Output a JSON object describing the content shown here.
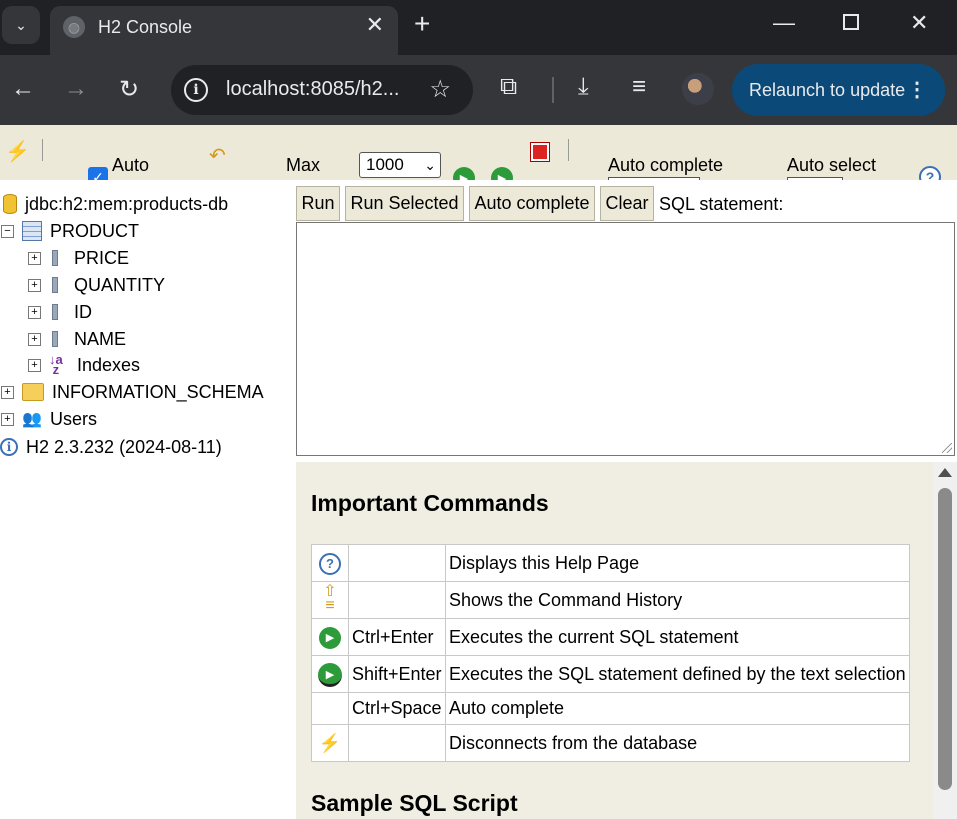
{
  "browser": {
    "tab_title": "H2 Console",
    "url": "localhost:8085/h2...",
    "relaunch_label": "Relaunch to update"
  },
  "h2_toolbar": {
    "auto_commit_label": "Auto",
    "auto_commit_checked": true,
    "max_label": "Max",
    "max_value": "1000",
    "auto_complete_label": "Auto complete",
    "auto_select_label": "Auto select"
  },
  "tree": {
    "connection": "jdbc:h2:mem:products-db",
    "table": "PRODUCT",
    "columns": [
      "PRICE",
      "QUANTITY",
      "ID",
      "NAME"
    ],
    "indexes": "Indexes",
    "schema": "INFORMATION_SCHEMA",
    "users": "Users",
    "version": "H2 2.3.232 (2024-08-11)"
  },
  "query": {
    "run": "Run",
    "run_selected": "Run Selected",
    "auto_complete": "Auto complete",
    "clear": "Clear",
    "sql_label": "SQL statement:",
    "sql_text": ""
  },
  "help": {
    "important_title": "Important Commands",
    "commands": [
      {
        "icon": "help-icon",
        "key": "",
        "desc": "Displays this Help Page"
      },
      {
        "icon": "history-icon",
        "key": "",
        "desc": "Shows the Command History"
      },
      {
        "icon": "run-icon",
        "key": "Ctrl+Enter",
        "desc": "Executes the current SQL statement"
      },
      {
        "icon": "run-selected-icon",
        "key": "Shift+Enter",
        "desc": "Executes the SQL statement defined by the text selection"
      },
      {
        "icon": "",
        "key": "Ctrl+Space",
        "desc": "Auto complete"
      },
      {
        "icon": "disconnect-icon",
        "key": "",
        "desc": "Disconnects from the database"
      }
    ],
    "sample_title": "Sample SQL Script"
  }
}
